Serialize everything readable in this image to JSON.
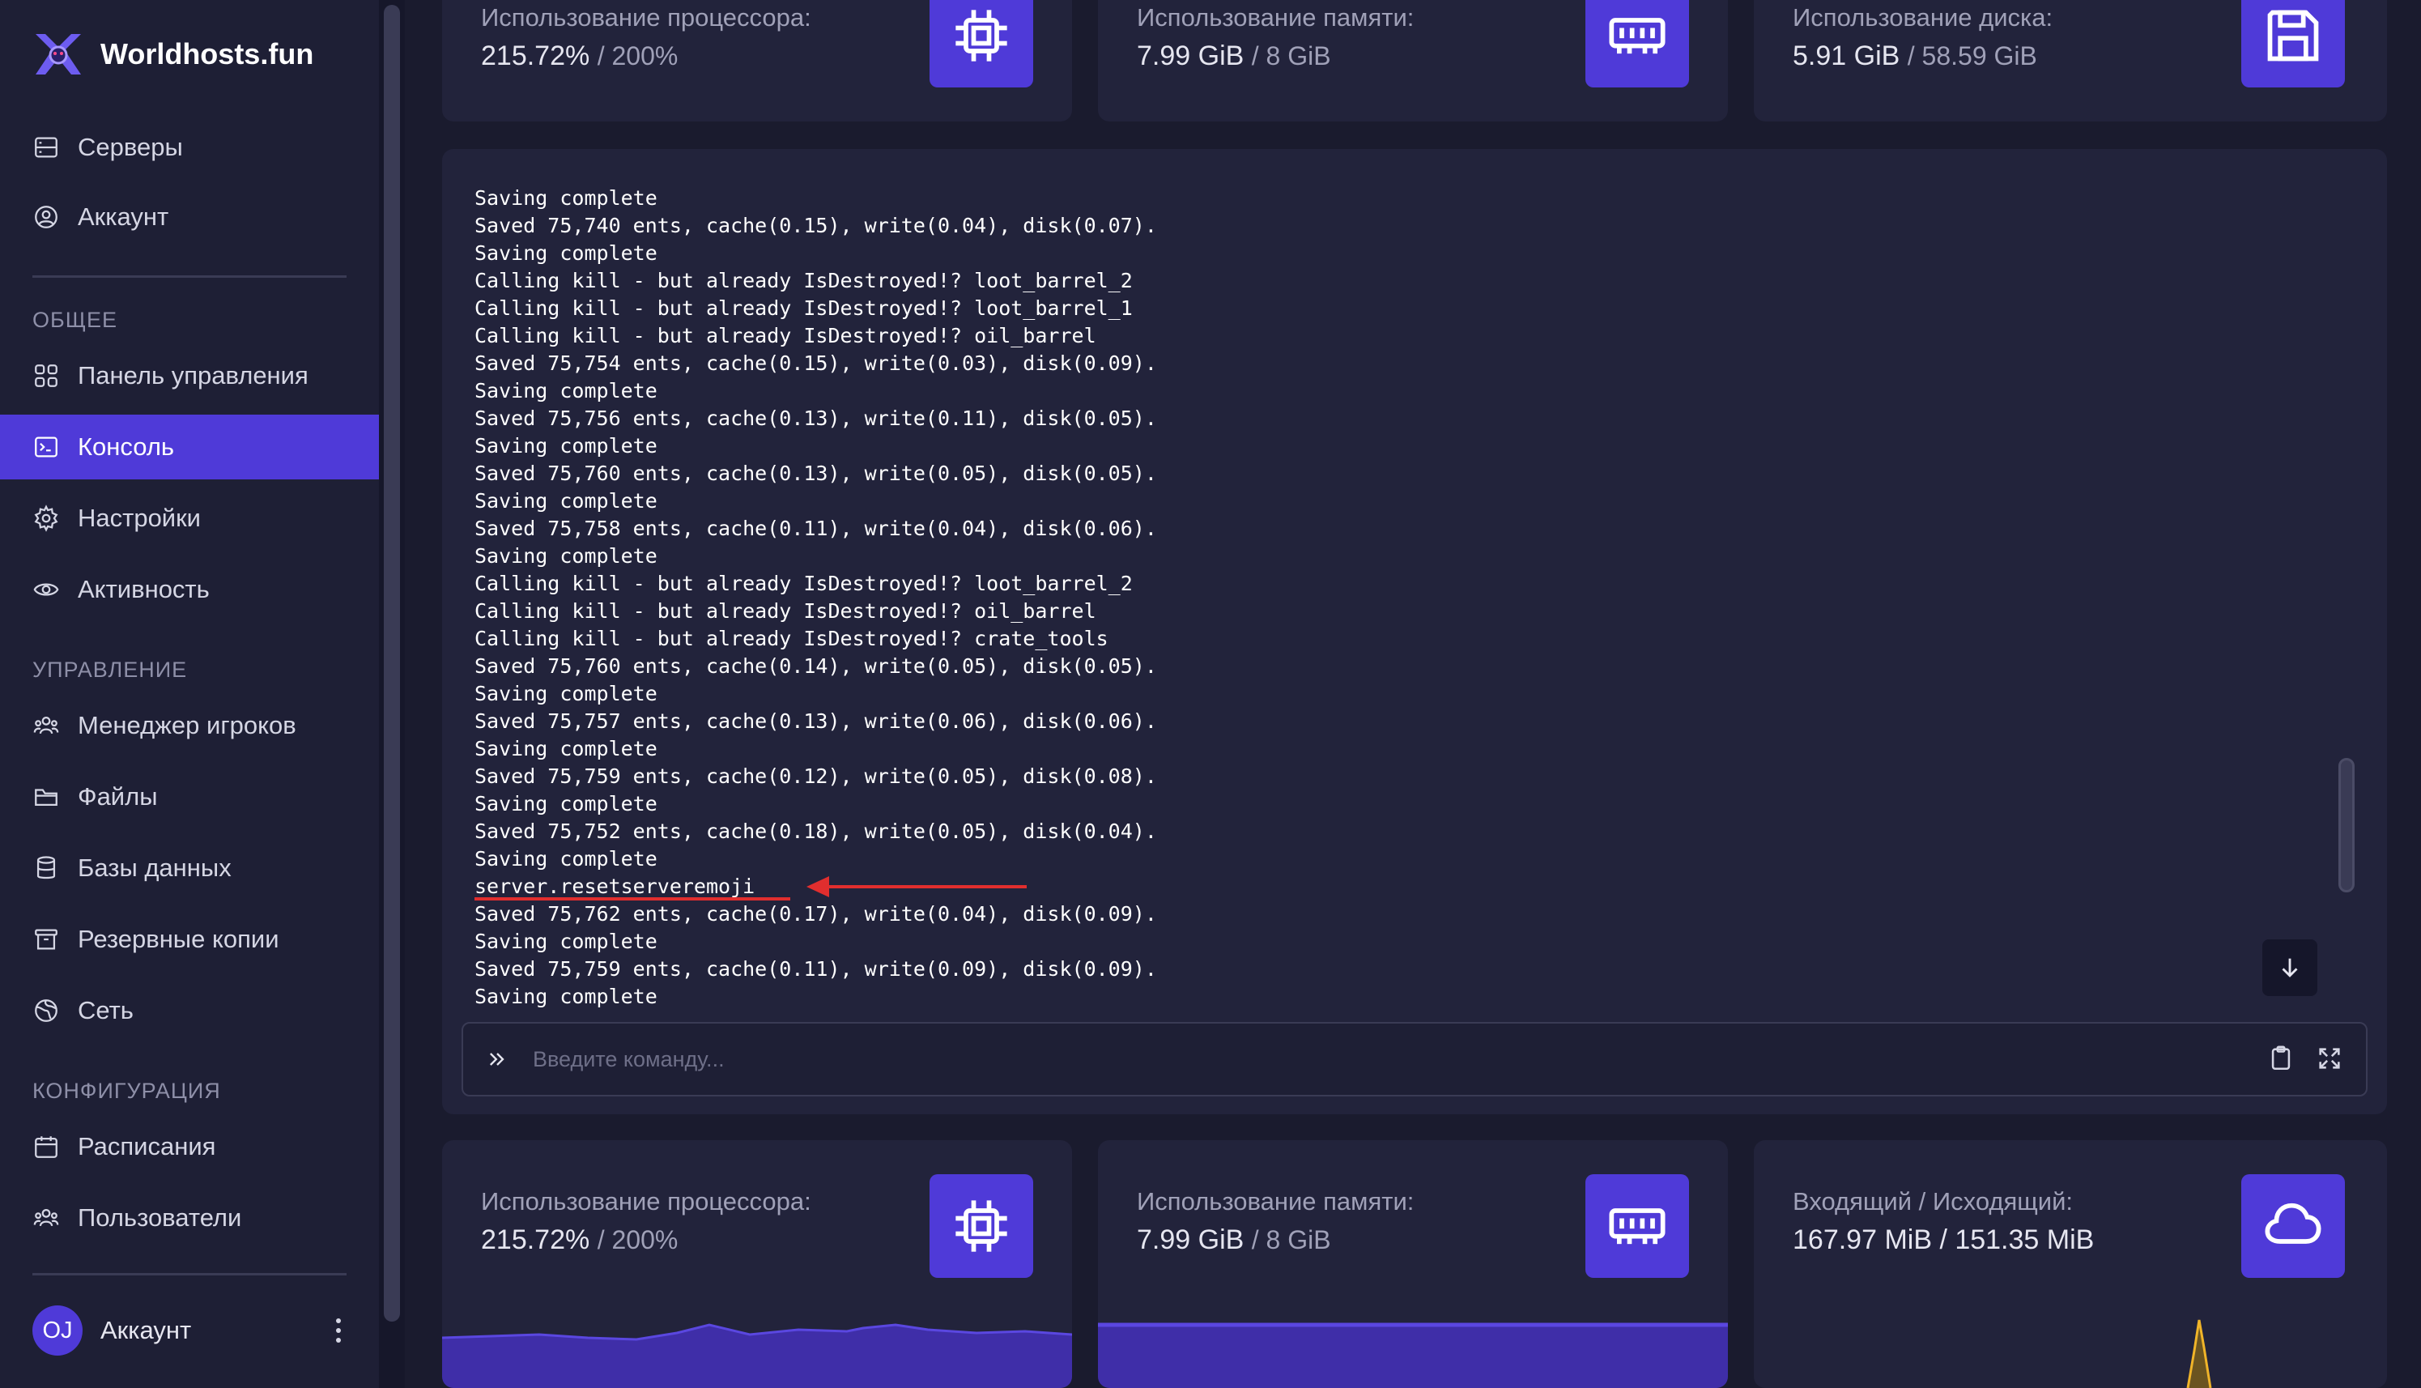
{
  "brand": {
    "name": "Worldhosts.fun"
  },
  "sidebar": {
    "top_items": [
      {
        "label": "Серверы",
        "icon": "server-icon"
      },
      {
        "label": "Аккаунт",
        "icon": "user-circle-icon"
      }
    ],
    "sections": [
      {
        "title": "ОБЩЕЕ",
        "items": [
          {
            "label": "Панель управления",
            "icon": "dashboard-icon",
            "active": false
          },
          {
            "label": "Консоль",
            "icon": "terminal-icon",
            "active": true
          },
          {
            "label": "Настройки",
            "icon": "gear-icon",
            "active": false
          },
          {
            "label": "Активность",
            "icon": "eye-icon",
            "active": false
          }
        ]
      },
      {
        "title": "УПРАВЛЕНИЕ",
        "items": [
          {
            "label": "Менеджер игроков",
            "icon": "users-group-icon"
          },
          {
            "label": "Файлы",
            "icon": "folder-icon"
          },
          {
            "label": "Базы данных",
            "icon": "database-icon"
          },
          {
            "label": "Резервные копии",
            "icon": "archive-icon"
          },
          {
            "label": "Сеть",
            "icon": "globe-icon"
          }
        ]
      },
      {
        "title": "КОНФИГУРАЦИЯ",
        "items": [
          {
            "label": "Расписания",
            "icon": "calendar-icon"
          },
          {
            "label": "Пользователи",
            "icon": "users-icon"
          }
        ]
      }
    ],
    "account": {
      "initials": "OJ",
      "label": "Аккаунт"
    }
  },
  "top_stats": [
    {
      "label": "Использование процессора:",
      "value": "215.72%",
      "limit": "/ 200%",
      "icon": "cpu-icon"
    },
    {
      "label": "Использование памяти:",
      "value": "7.99 GiB",
      "limit": "/ 8 GiB",
      "icon": "memory-icon"
    },
    {
      "label": "Использование диска:",
      "value": "5.91 GiB",
      "limit": "/ 58.59 GiB",
      "icon": "floppy-disk-icon"
    }
  ],
  "bottom_stats": [
    {
      "label": "Использование процессора:",
      "value": "215.72%",
      "limit": "/ 200%",
      "icon": "cpu-icon"
    },
    {
      "label": "Использование памяти:",
      "value": "7.99 GiB",
      "limit": "/ 8 GiB",
      "icon": "memory-icon"
    },
    {
      "label": "Входящий / Исходящий:",
      "value": "167.97 MiB / 151.35 MiB",
      "limit": "",
      "icon": "cloud-icon"
    }
  ],
  "console": {
    "lines": [
      "Saving complete",
      "Saved 75,740 ents, cache(0.15), write(0.04), disk(0.07).",
      "Saving complete",
      "Calling kill - but already IsDestroyed!? loot_barrel_2",
      "Calling kill - but already IsDestroyed!? loot_barrel_1",
      "Calling kill - but already IsDestroyed!? oil_barrel",
      "Saved 75,754 ents, cache(0.15), write(0.03), disk(0.09).",
      "Saving complete",
      "Saved 75,756 ents, cache(0.13), write(0.11), disk(0.05).",
      "Saving complete",
      "Saved 75,760 ents, cache(0.13), write(0.05), disk(0.05).",
      "Saving complete",
      "Saved 75,758 ents, cache(0.11), write(0.04), disk(0.06).",
      "Saving complete",
      "Calling kill - but already IsDestroyed!? loot_barrel_2",
      "Calling kill - but already IsDestroyed!? oil_barrel",
      "Calling kill - but already IsDestroyed!? crate_tools",
      "Saved 75,760 ents, cache(0.14), write(0.05), disk(0.05).",
      "Saving complete",
      "Saved 75,757 ents, cache(0.13), write(0.06), disk(0.06).",
      "Saving complete",
      "Saved 75,759 ents, cache(0.12), write(0.05), disk(0.08).",
      "Saving complete",
      "Saved 75,752 ents, cache(0.18), write(0.05), disk(0.04).",
      "Saving complete",
      "server.resetserveremoji",
      "Saved 75,762 ents, cache(0.17), write(0.04), disk(0.09).",
      "Saving complete",
      "Saved 75,759 ents, cache(0.11), write(0.09), disk(0.09).",
      "Saving complete"
    ],
    "command_placeholder": "Введите команду..."
  },
  "colors": {
    "accent": "#4f3ad8",
    "annotation_red": "#e12e2e",
    "background": "#1a1b2e",
    "card": "#22233b"
  }
}
